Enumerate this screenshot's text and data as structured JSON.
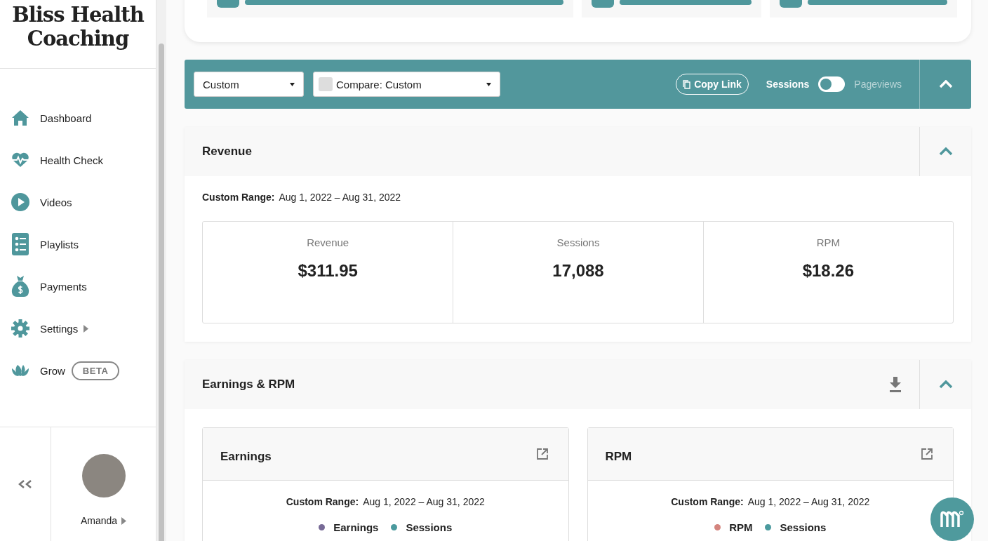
{
  "brand": {
    "name": "Bliss Health Coaching"
  },
  "sidebar": {
    "items": [
      {
        "label": "Dashboard",
        "submenu": false
      },
      {
        "label": "Health Check",
        "submenu": false
      },
      {
        "label": "Videos",
        "submenu": false
      },
      {
        "label": "Playlists",
        "submenu": false
      },
      {
        "label": "Payments",
        "submenu": false
      },
      {
        "label": "Settings",
        "submenu": true
      },
      {
        "label": "Grow",
        "submenu": false,
        "badge": "BETA"
      }
    ]
  },
  "user": {
    "name": "Amanda"
  },
  "toolbar": {
    "range_select": {
      "value": "Custom"
    },
    "compare_select": {
      "value": "Compare: Custom"
    },
    "copy_link": "Copy Link",
    "metric_toggle": {
      "on": false,
      "options": [
        {
          "label": "Sessions",
          "selected": true
        },
        {
          "label": "Pageviews",
          "selected": false
        }
      ]
    }
  },
  "revenue": {
    "title": "Revenue",
    "range_label": "Custom Range:",
    "range": "Aug 1, 2022 – Aug 31, 2022",
    "stats": [
      {
        "label": "Revenue",
        "value": "$311.95"
      },
      {
        "label": "Sessions",
        "value": "17,088"
      },
      {
        "label": "RPM",
        "value": "$18.26"
      }
    ]
  },
  "earnings_rpm": {
    "title": "Earnings & RPM",
    "cards": [
      {
        "title": "Earnings",
        "range_label": "Custom Range:",
        "range": "Aug 1, 2022 – Aug 31, 2022",
        "legend": [
          {
            "label": "Earnings",
            "color": "#776a96"
          },
          {
            "label": "Sessions",
            "color": "#4b9a9e"
          }
        ]
      },
      {
        "title": "RPM",
        "range_label": "Custom Range:",
        "range": "Aug 1, 2022 – Aug 31, 2022",
        "legend": [
          {
            "label": "RPM",
            "color": "#d4847e"
          },
          {
            "label": "Sessions",
            "color": "#4b9a9e"
          }
        ]
      }
    ]
  }
}
